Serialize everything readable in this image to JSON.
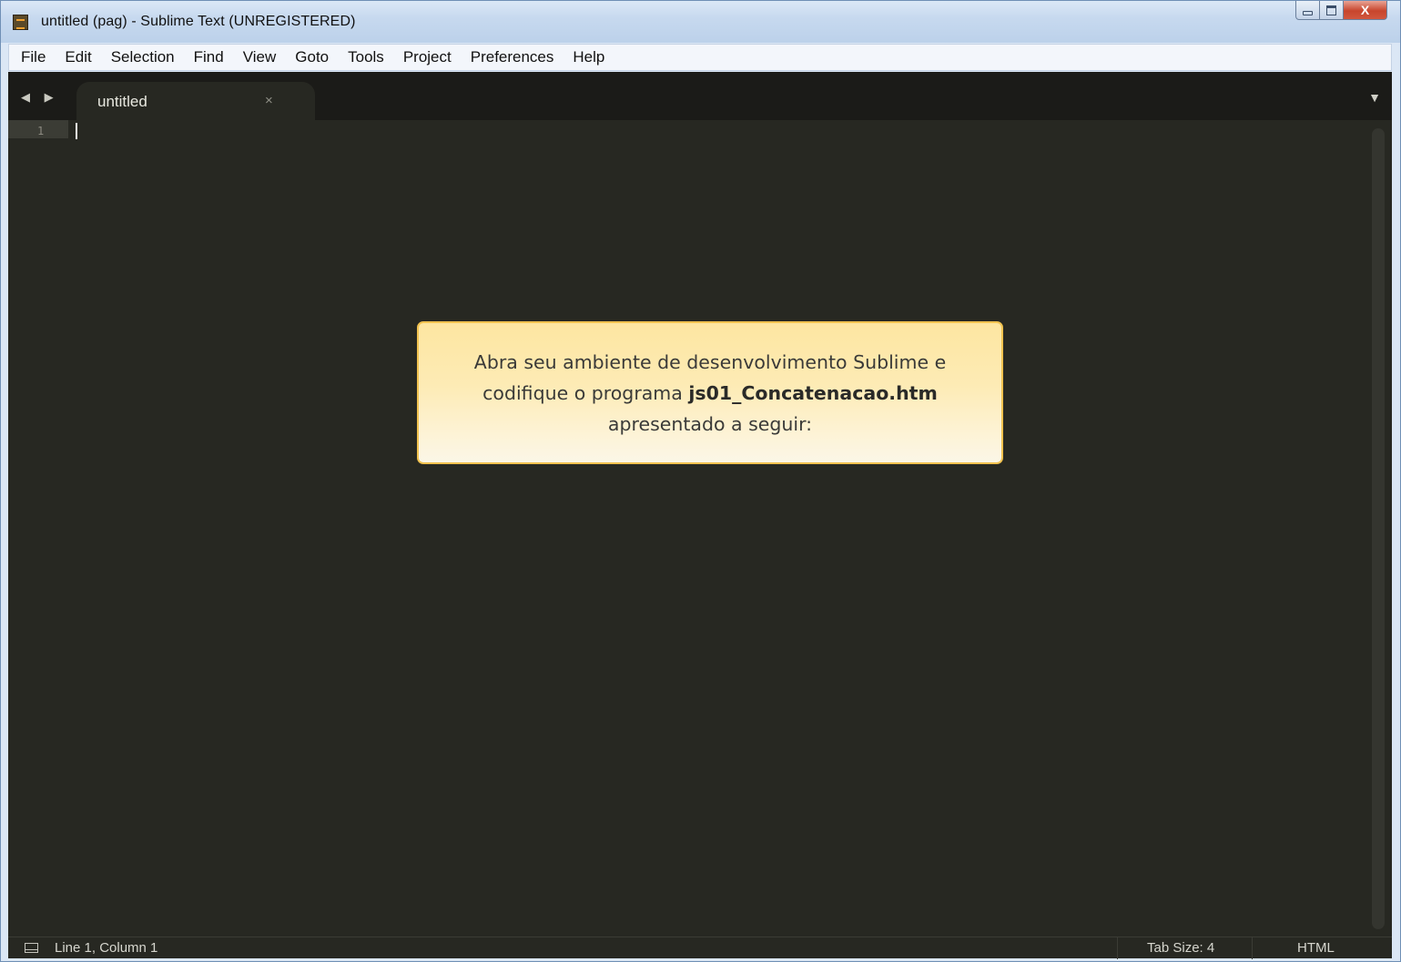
{
  "window": {
    "title": "untitled (pag) - Sublime Text (UNREGISTERED)",
    "controls": {
      "minimize": "minimize",
      "maximize": "maximize",
      "close": "X"
    }
  },
  "menu": [
    "File",
    "Edit",
    "Selection",
    "Find",
    "View",
    "Goto",
    "Tools",
    "Project",
    "Preferences",
    "Help"
  ],
  "tabs": {
    "active": {
      "label": "untitled",
      "close": "×"
    },
    "nav": "◀ ▶",
    "menu_glyph": "▼"
  },
  "editor": {
    "line_number": "1"
  },
  "callout": {
    "line1": "Abra seu ambiente de desenvolvimento Sublime e",
    "line2_prefix": "codifique o programa",
    "filename": "js01_Concatenacao.htm",
    "line3": "apresentado a seguir:",
    "border_color": "#f1c24f"
  },
  "status": {
    "position": "Line 1, Column 1",
    "tab_size": "Tab Size: 4",
    "syntax": "HTML"
  },
  "colors": {
    "editor_bg": "#272822",
    "tabbar_bg": "#1b1b18"
  }
}
